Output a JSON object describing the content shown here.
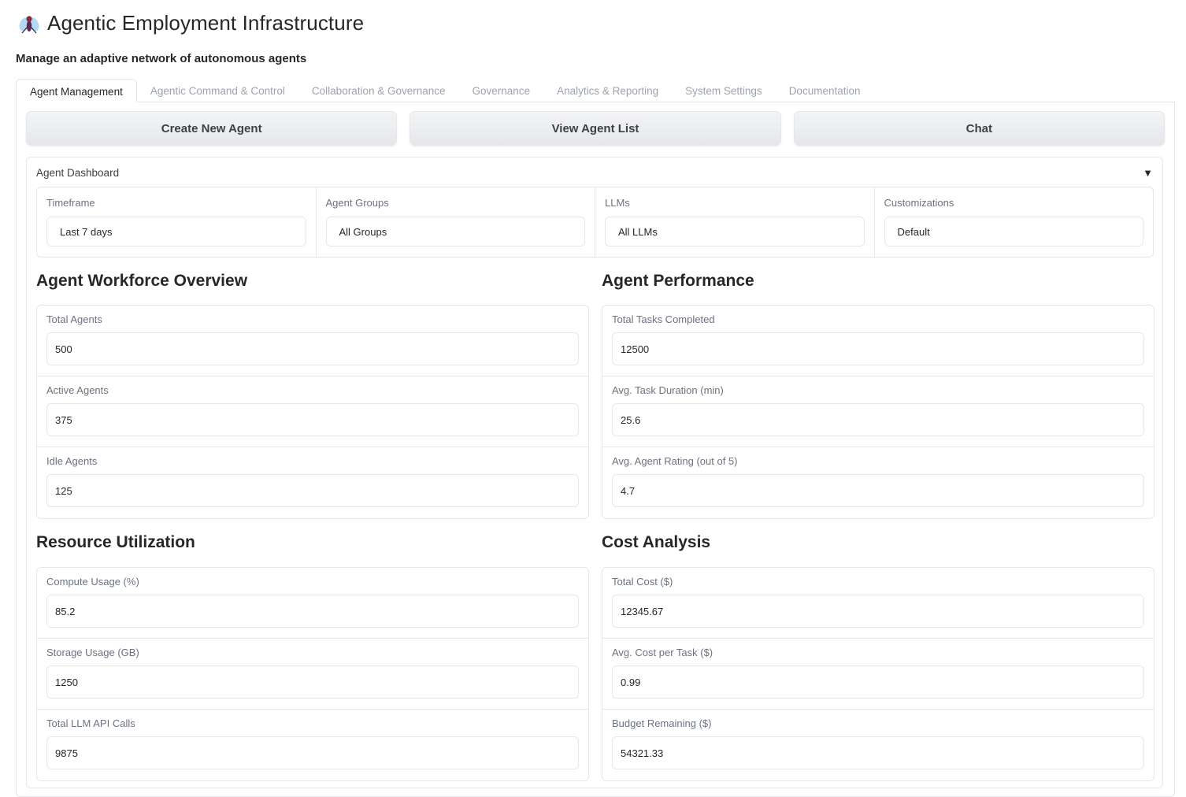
{
  "app": {
    "title": "Agentic Employment Infrastructure",
    "subtitle": "Manage an adaptive network of autonomous agents",
    "logo_icon": "fly-icon"
  },
  "tabs": [
    {
      "label": "Agent Management",
      "active": true
    },
    {
      "label": "Agentic Command & Control"
    },
    {
      "label": "Collaboration & Governance"
    },
    {
      "label": "Governance"
    },
    {
      "label": "Analytics & Reporting"
    },
    {
      "label": "System Settings"
    },
    {
      "label": "Documentation"
    }
  ],
  "actions": {
    "create_label": "Create New Agent",
    "view_label": "View Agent List",
    "chat_label": "Chat"
  },
  "dashboard": {
    "title": "Agent Dashboard",
    "toggle_icon": "triangle-down-icon",
    "filters": {
      "timeframe": {
        "label": "Timeframe",
        "value": "Last 7 days"
      },
      "groups": {
        "label": "Agent Groups",
        "value": "All Groups"
      },
      "llms": {
        "label": "LLMs",
        "value": "All LLMs"
      },
      "customizations": {
        "label": "Customizations",
        "value": "Default"
      }
    },
    "workforce": {
      "title": "Agent Workforce Overview",
      "rows": [
        {
          "label": "Total Agents",
          "value": "500"
        },
        {
          "label": "Active Agents",
          "value": "375"
        },
        {
          "label": "Idle Agents",
          "value": "125"
        }
      ]
    },
    "performance": {
      "title": "Agent Performance",
      "rows": [
        {
          "label": "Total Tasks Completed",
          "value": "12500"
        },
        {
          "label": "Avg. Task Duration (min)",
          "value": "25.6"
        },
        {
          "label": "Avg. Agent Rating (out of 5)",
          "value": "4.7"
        }
      ]
    },
    "resources": {
      "title": "Resource Utilization",
      "rows": [
        {
          "label": "Compute Usage (%)",
          "value": "85.2"
        },
        {
          "label": "Storage Usage (GB)",
          "value": "1250"
        },
        {
          "label": "Total LLM API Calls",
          "value": "9875"
        }
      ]
    },
    "cost": {
      "title": "Cost Analysis",
      "rows": [
        {
          "label": "Total Cost ($)",
          "value": "12345.67"
        },
        {
          "label": "Avg. Cost per Task ($)",
          "value": "0.99"
        },
        {
          "label": "Budget Remaining ($)",
          "value": "54321.33"
        }
      ]
    }
  }
}
